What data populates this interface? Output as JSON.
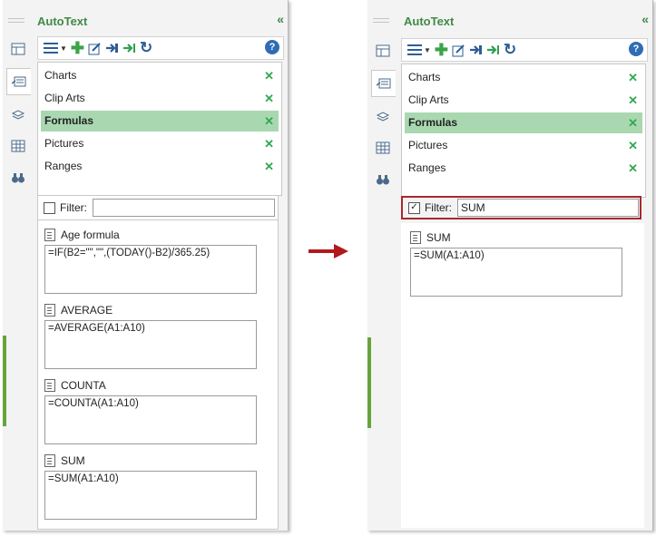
{
  "panels": [
    {
      "title": "AutoText",
      "collapse_glyph": "«",
      "help_glyph": "?",
      "categories": [
        {
          "label": "Charts",
          "selected": false
        },
        {
          "label": "Clip Arts",
          "selected": false
        },
        {
          "label": "Formulas",
          "selected": true
        },
        {
          "label": "Pictures",
          "selected": false
        },
        {
          "label": "Ranges",
          "selected": false
        }
      ],
      "filter": {
        "label": "Filter:",
        "value": "",
        "checked": false
      },
      "entries": [
        {
          "name": "Age formula",
          "content": "=IF(B2=\"\",\"\",(TODAY()-B2)/365.25)"
        },
        {
          "name": "AVERAGE",
          "content": "=AVERAGE(A1:A10)"
        },
        {
          "name": "COUNTA",
          "content": "=COUNTA(A1:A10)"
        },
        {
          "name": "SUM",
          "content": "=SUM(A1:A10)"
        }
      ]
    },
    {
      "title": "AutoText",
      "collapse_glyph": "«",
      "help_glyph": "?",
      "categories": [
        {
          "label": "Charts",
          "selected": false
        },
        {
          "label": "Clip Arts",
          "selected": false
        },
        {
          "label": "Formulas",
          "selected": true
        },
        {
          "label": "Pictures",
          "selected": false
        },
        {
          "label": "Ranges",
          "selected": false
        }
      ],
      "filter": {
        "label": "Filter:",
        "value": "SUM",
        "checked": true
      },
      "entries": [
        {
          "name": "SUM",
          "content": "=SUM(A1:A10)"
        }
      ]
    }
  ],
  "icons": {
    "sidebar": [
      "table-icon",
      "autotext-icon",
      "stack-icon",
      "grid-icon",
      "binoculars-icon"
    ],
    "toolbar": [
      "menu-list-icon",
      "dropdown-caret-icon",
      "add-icon",
      "edit-icon",
      "insert-arrow-icon",
      "export-icon",
      "refresh-icon"
    ]
  },
  "colors": {
    "accent_green": "#3f8a49",
    "selection": "#a9d8b0",
    "delete_x": "#33a853",
    "highlight_frame": "#a8282e",
    "arrow": "#b0191e"
  }
}
